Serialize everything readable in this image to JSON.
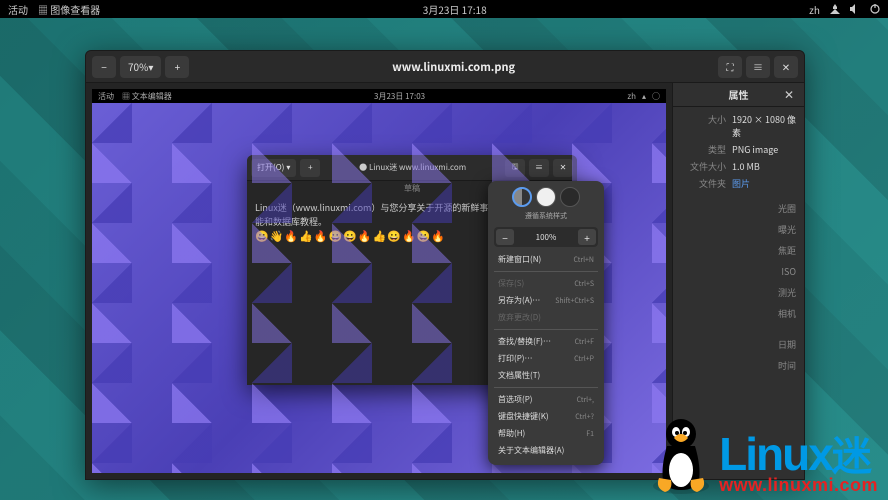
{
  "topbar": {
    "activities": "活动",
    "app": "图像查看器",
    "clock": "3月23日  17:18",
    "ime": "zh"
  },
  "viewer": {
    "zoom_minus": "−",
    "zoom_pct": "70%",
    "zoom_plus": "+",
    "title": "www.linuxmi.com.png"
  },
  "inner": {
    "activities": "活动",
    "app": "文本编辑器",
    "clock": "3月23日  17:03"
  },
  "editor": {
    "open_label": "打开(O)",
    "tab_title": "Linux迷 www.linuxmi.com",
    "sub": "草稿",
    "line1": "Linux迷（www.linuxmi.com）与您分享关于开源的新鲜事，Linux、编程",
    "line2": "能和数据库教程。",
    "emojis": "😀👋🔥👍🔥😀😀🔥👍😀🔥😀🔥"
  },
  "popover": {
    "theme_label": "遵循系统样式",
    "zoom_minus": "−",
    "zoom_val": "100%",
    "zoom_plus": "+",
    "items": [
      {
        "label": "新建窗口(N)",
        "sc": "Ctrl+N",
        "sep": false
      },
      {
        "label": "保存(S)",
        "sc": "Ctrl+S",
        "sep": true,
        "disabled": true
      },
      {
        "label": "另存为(A)…",
        "sc": "Shift+Ctrl+S"
      },
      {
        "label": "放弃更改(D)",
        "sc": "",
        "disabled": true
      },
      {
        "label": "查找/替换(F)…",
        "sc": "Ctrl+F",
        "sep": true
      },
      {
        "label": "打印(P)…",
        "sc": "Ctrl+P"
      },
      {
        "label": "文档属性(T)",
        "sc": ""
      },
      {
        "label": "首选项(P)",
        "sc": "Ctrl+,",
        "sep": true
      },
      {
        "label": "键盘快捷键(K)",
        "sc": "Ctrl+?"
      },
      {
        "label": "帮助(H)",
        "sc": "F1"
      },
      {
        "label": "关于文本编辑器(A)",
        "sc": ""
      }
    ]
  },
  "props": {
    "title": "属性",
    "size_k": "大小",
    "size_v": "1920 × 1080 像素",
    "type_k": "类型",
    "type_v": "PNG image",
    "fsize_k": "文件大小",
    "fsize_v": "1.0 MB",
    "folder_k": "文件夹",
    "folder_v": "图片",
    "aperture": "光圈",
    "exposure": "曝光",
    "focal": "焦距",
    "iso": "ISO",
    "metering": "测光",
    "camera": "相机",
    "date": "日期",
    "time": "时间"
  },
  "wm": {
    "logo": "Linux",
    "mi": "迷",
    "url": "www.linuxmi.com"
  }
}
